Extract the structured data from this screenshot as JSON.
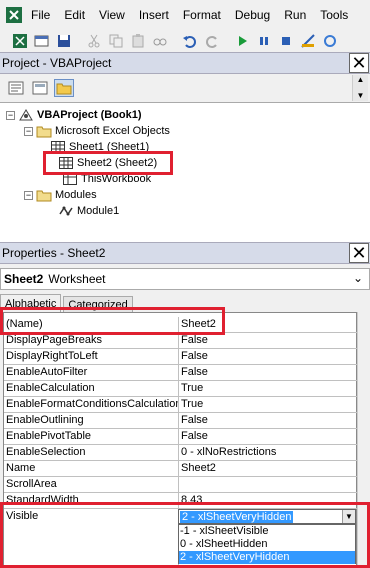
{
  "menubar": {
    "items": [
      "File",
      "Edit",
      "View",
      "Insert",
      "Format",
      "Debug",
      "Run",
      "Tools"
    ]
  },
  "project_panel": {
    "title": "Project - VBAProject",
    "tree": {
      "root": "VBAProject (Book1)",
      "folder1": "Microsoft Excel Objects",
      "sheet1": "Sheet1 (Sheet1)",
      "sheet2": "Sheet2 (Sheet2)",
      "workbook": "ThisWorkbook",
      "folder2": "Modules",
      "module1": "Module1"
    }
  },
  "properties_panel": {
    "title": "Properties - Sheet2",
    "object_name": "Sheet2",
    "object_type": "Worksheet",
    "tabs": [
      "Alphabetic",
      "Categorized"
    ],
    "rows": [
      {
        "name": "(Name)",
        "value": "Sheet2"
      },
      {
        "name": "DisplayPageBreaks",
        "value": "False"
      },
      {
        "name": "DisplayRightToLeft",
        "value": "False"
      },
      {
        "name": "EnableAutoFilter",
        "value": "False"
      },
      {
        "name": "EnableCalculation",
        "value": "True"
      },
      {
        "name": "EnableFormatConditionsCalculation",
        "value": "True"
      },
      {
        "name": "EnableOutlining",
        "value": "False"
      },
      {
        "name": "EnablePivotTable",
        "value": "False"
      },
      {
        "name": "EnableSelection",
        "value": "0 - xlNoRestrictions"
      },
      {
        "name": "Name",
        "value": "Sheet2"
      },
      {
        "name": "ScrollArea",
        "value": ""
      },
      {
        "name": "StandardWidth",
        "value": "8.43"
      },
      {
        "name": "Visible",
        "value": "2 - xlSheetVeryHidden"
      }
    ],
    "visible_options": [
      "-1 - xlSheetVisible",
      "0 - xlSheetHidden",
      "2 - xlSheetVeryHidden"
    ]
  },
  "colors": {
    "highlight": "#e02030",
    "selection": "#3399ff",
    "panel_header": "#d6dbe9"
  }
}
